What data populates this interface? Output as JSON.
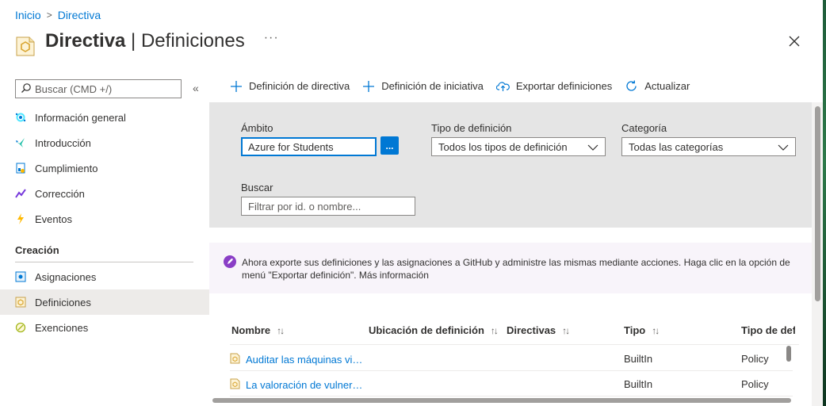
{
  "breadcrumb": {
    "home": "Inicio",
    "current": "Directiva"
  },
  "header": {
    "title_bold": "Directiva",
    "title_sep": " | ",
    "title_rest": "Definiciones",
    "more": "···"
  },
  "sidebar": {
    "search_placeholder": "Buscar (CMD +/)",
    "collapse": "«",
    "items": [
      {
        "label": "Información general",
        "icon": "overview-icon"
      },
      {
        "label": "Introducción",
        "icon": "getting-started-icon"
      },
      {
        "label": "Cumplimiento",
        "icon": "compliance-icon"
      },
      {
        "label": "Corrección",
        "icon": "remediation-icon"
      },
      {
        "label": "Eventos",
        "icon": "events-icon"
      }
    ],
    "section": "Creación",
    "authoring": [
      {
        "label": "Asignaciones",
        "icon": "assignments-icon"
      },
      {
        "label": "Definiciones",
        "icon": "definitions-icon",
        "selected": true
      },
      {
        "label": "Exenciones",
        "icon": "exemptions-icon"
      }
    ]
  },
  "toolbar": {
    "policy_definition": "Definición de directiva",
    "initiative_definition": "Definición de iniciativa",
    "export": "Exportar definiciones",
    "refresh": "Actualizar"
  },
  "filters": {
    "scope_label": "Ámbito",
    "scope_value": "Azure for Students",
    "scope_button": "...",
    "type_label": "Tipo de definición",
    "type_value": "Todos los tipos de definición",
    "category_label": "Categoría",
    "category_value": "Todas las categorías",
    "search_label": "Buscar",
    "search_placeholder": "Filtrar por id. o nombre..."
  },
  "banner": {
    "text": "Ahora exporte sus definiciones y las asignaciones a GitHub y administre las mismas mediante acciones. Haga clic en la opción de menú \"Exportar definición\". Más información"
  },
  "table": {
    "columns": [
      "Nombre",
      "Ubicación de definición",
      "Directivas",
      "Tipo",
      "Tipo de def"
    ],
    "sort_glyph": "↑↓",
    "rows": [
      {
        "name": "Auditar las máquinas vi…",
        "type": "BuiltIn",
        "def_type": "Policy"
      },
      {
        "name": "La valoración de vulner…",
        "type": "BuiltIn",
        "def_type": "Policy"
      }
    ]
  },
  "colors": {
    "accent": "#0078d4",
    "filter_bg": "#e5e5e5",
    "banner_bg": "#f8f4fa",
    "selected_bg": "#edebe9"
  }
}
